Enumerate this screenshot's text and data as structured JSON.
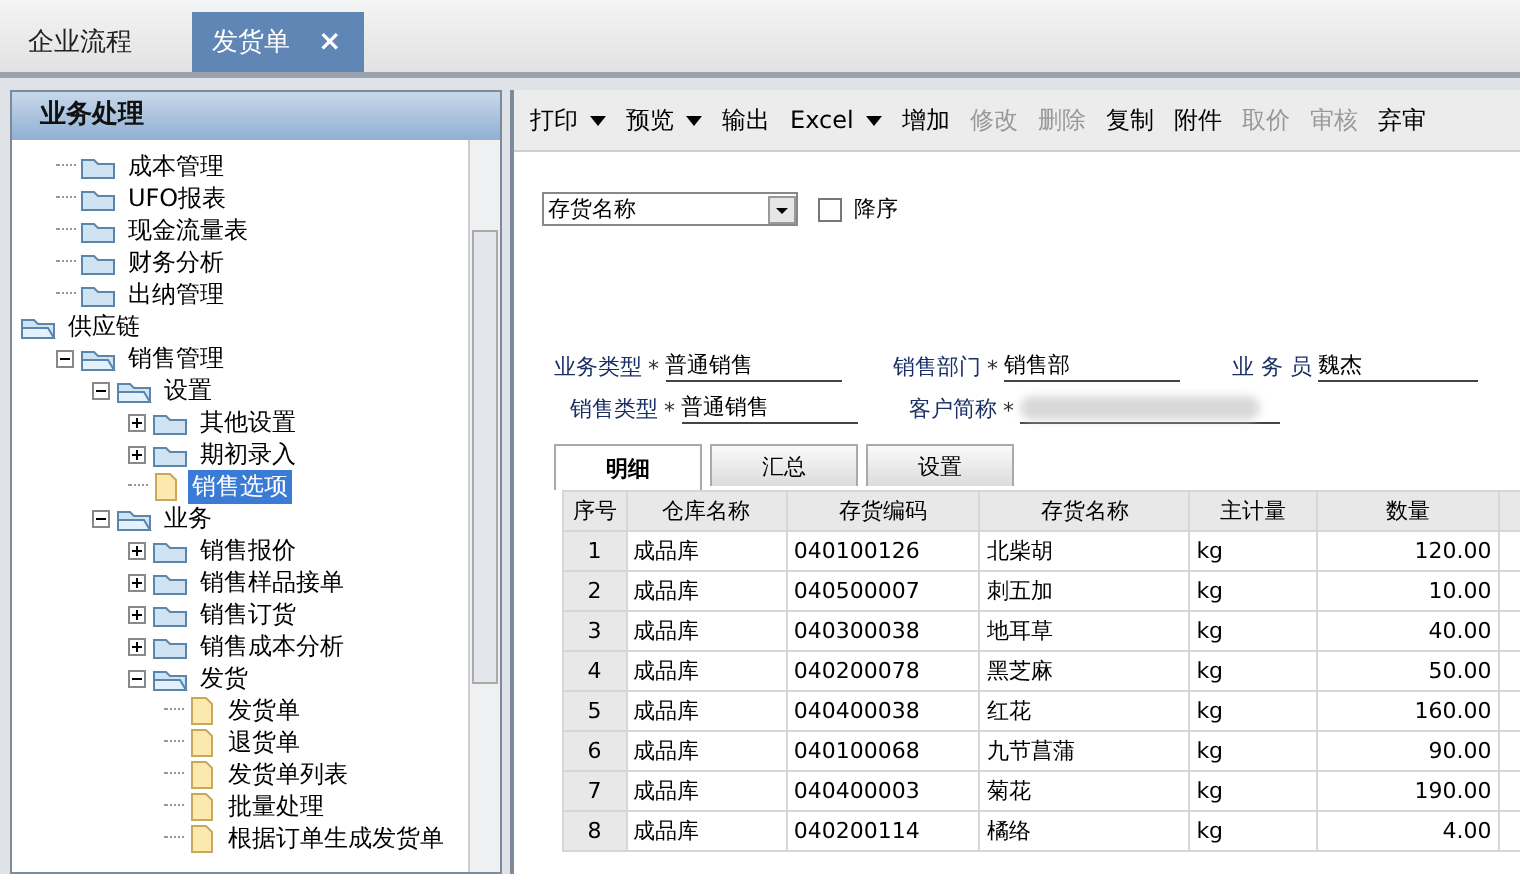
{
  "doc_tabs": [
    {
      "label": "企业流程",
      "selected": false
    },
    {
      "label": "发货单",
      "selected": true,
      "close": "×"
    }
  ],
  "sidebar": {
    "title": "业务处理",
    "tree": [
      {
        "label": "成本管理",
        "kind": "stub"
      },
      {
        "label": "UFO报表",
        "kind": "stub"
      },
      {
        "label": "现金流量表",
        "kind": "stub"
      },
      {
        "label": "财务分析",
        "kind": "stub"
      },
      {
        "label": "出纳管理",
        "kind": "stub"
      },
      {
        "label": "供应链",
        "kind": "folder",
        "expanded": true,
        "children": [
          {
            "label": "销售管理",
            "kind": "folder",
            "expanded": true,
            "children": [
              {
                "label": "设置",
                "kind": "folder",
                "expanded": true,
                "children": [
                  {
                    "label": "其他设置",
                    "kind": "folder",
                    "expanded": false
                  },
                  {
                    "label": "期初录入",
                    "kind": "folder",
                    "expanded": false
                  },
                  {
                    "label": "销售选项",
                    "kind": "doc",
                    "selected": true
                  }
                ]
              },
              {
                "label": "业务",
                "kind": "folder",
                "expanded": true,
                "children": [
                  {
                    "label": "销售报价",
                    "kind": "folder",
                    "expanded": false
                  },
                  {
                    "label": "销售样品接单",
                    "kind": "folder",
                    "expanded": false
                  },
                  {
                    "label": "销售订货",
                    "kind": "folder",
                    "expanded": false
                  },
                  {
                    "label": "销售成本分析",
                    "kind": "folder",
                    "expanded": false
                  },
                  {
                    "label": "发货",
                    "kind": "folder",
                    "expanded": true,
                    "children": [
                      {
                        "label": "发货单",
                        "kind": "doc",
                        "selected": false
                      },
                      {
                        "label": "退货单",
                        "kind": "doc",
                        "selected": false
                      },
                      {
                        "label": "发货单列表",
                        "kind": "doc",
                        "selected": false
                      },
                      {
                        "label": "批量处理",
                        "kind": "doc",
                        "selected": false
                      },
                      {
                        "label": "根据订单生成发货单",
                        "kind": "doc",
                        "selected": false
                      }
                    ]
                  }
                ]
              }
            ]
          }
        ]
      }
    ]
  },
  "toolbar": [
    {
      "label": "打印",
      "dropdown": true,
      "disabled": false
    },
    {
      "label": "预览",
      "dropdown": true,
      "disabled": false
    },
    {
      "label": "输出",
      "dropdown": false,
      "disabled": false
    },
    {
      "label": "Excel",
      "dropdown": true,
      "disabled": false
    },
    {
      "label": "增加",
      "dropdown": false,
      "disabled": false
    },
    {
      "label": "修改",
      "dropdown": false,
      "disabled": true
    },
    {
      "label": "删除",
      "dropdown": false,
      "disabled": true
    },
    {
      "label": "复制",
      "dropdown": false,
      "disabled": false
    },
    {
      "label": "附件",
      "dropdown": false,
      "disabled": false
    },
    {
      "label": "取价",
      "dropdown": false,
      "disabled": true
    },
    {
      "label": "审核",
      "dropdown": false,
      "disabled": true
    },
    {
      "label": "弃审",
      "dropdown": false,
      "disabled": false
    }
  ],
  "sort": {
    "field": "存货名称",
    "descending_label": "降序",
    "descending": false
  },
  "form": [
    [
      {
        "label": "业务类型",
        "marker": "*",
        "value": "普通销售"
      },
      {
        "label": "销售部门",
        "marker": "*",
        "value": "销售部"
      },
      {
        "label": "业 务 员",
        "value": "魏杰"
      }
    ],
    [
      {
        "label": "销售类型",
        "marker": "*",
        "value": "普通销售"
      },
      {
        "label": "客户简称",
        "marker": "*",
        "redacted": true
      }
    ]
  ],
  "detail_tabs": [
    {
      "label": "明细",
      "selected": true
    },
    {
      "label": "汇总",
      "selected": false
    },
    {
      "label": "设置",
      "selected": false
    }
  ],
  "table": {
    "columns": [
      "序号",
      "仓库名称",
      "存货编码",
      "存货名称",
      "主计量",
      "数量"
    ],
    "rows": [
      [
        "1",
        "成品库",
        "040100126",
        "北柴胡",
        "kg",
        "120.00"
      ],
      [
        "2",
        "成品库",
        "040500007",
        "刺五加",
        "kg",
        "10.00"
      ],
      [
        "3",
        "成品库",
        "040300038",
        "地耳草",
        "kg",
        "40.00"
      ],
      [
        "4",
        "成品库",
        "040200078",
        "黑芝麻",
        "kg",
        "50.00"
      ],
      [
        "5",
        "成品库",
        "040400038",
        "红花",
        "kg",
        "160.00"
      ],
      [
        "6",
        "成品库",
        "040100068",
        "九节菖蒲",
        "kg",
        "90.00"
      ],
      [
        "7",
        "成品库",
        "040400003",
        "菊花",
        "kg",
        "190.00"
      ],
      [
        "8",
        "成品库",
        "040200114",
        "橘络",
        "kg",
        "4.00"
      ]
    ]
  }
}
